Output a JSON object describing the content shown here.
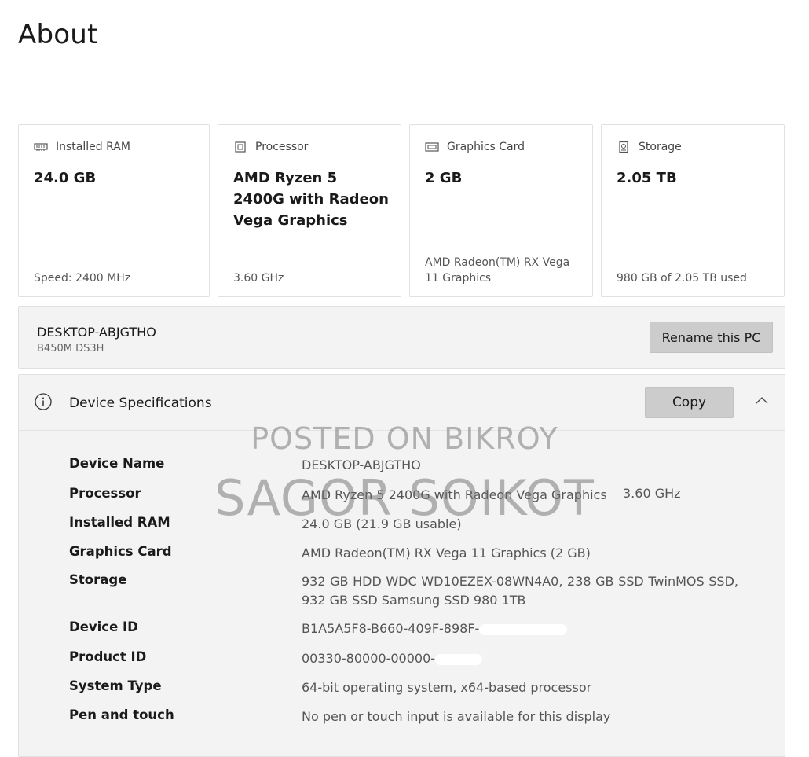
{
  "page": {
    "title": "About"
  },
  "cards": [
    {
      "icon": "ram-icon",
      "label": "Installed RAM",
      "value": "24.0 GB",
      "sub": "Speed: 2400 MHz"
    },
    {
      "icon": "processor-icon",
      "label": "Processor",
      "value": "AMD Ryzen 5 2400G with Radeon Vega Graphics",
      "sub": "3.60 GHz"
    },
    {
      "icon": "graphics-card-icon",
      "label": "Graphics Card",
      "value": "2 GB",
      "sub": "AMD Radeon(TM) RX Vega 11 Graphics"
    },
    {
      "icon": "storage-icon",
      "label": "Storage",
      "value": "2.05 TB",
      "sub": "980 GB of 2.05 TB used"
    }
  ],
  "pc": {
    "name": "DESKTOP-ABJGTHO",
    "model": "B450M DS3H",
    "rename_label": "Rename this PC"
  },
  "specs": {
    "title": "Device Specifications",
    "copy_label": "Copy",
    "rows": [
      {
        "label": "Device Name",
        "value": "DESKTOP-ABJGTHO"
      },
      {
        "label": "Processor",
        "value": "AMD Ryzen 5 2400G with Radeon Vega Graphics",
        "extra": "3.60 GHz"
      },
      {
        "label": "Installed RAM",
        "value": "24.0 GB (21.9 GB usable)"
      },
      {
        "label": "Graphics Card",
        "value": "AMD Radeon(TM) RX Vega 11 Graphics (2 GB)"
      },
      {
        "label": "Storage",
        "value": "932 GB HDD WDC WD10EZEX-08WN4A0, 238 GB SSD TwinMOS SSD, 932 GB SSD Samsung SSD 980 1TB"
      },
      {
        "label": "Device ID",
        "value": "B1A5A5F8-B660-409F-898F-"
      },
      {
        "label": "Product ID",
        "value": "00330-80000-00000-"
      },
      {
        "label": "System Type",
        "value": "64-bit operating system, x64-based processor"
      },
      {
        "label": "Pen and touch",
        "value": "No pen or touch input is available for this display"
      }
    ]
  },
  "watermark": {
    "line1": "POSTED ON BIKROY",
    "line2": "SAGOR SOIKOT"
  }
}
